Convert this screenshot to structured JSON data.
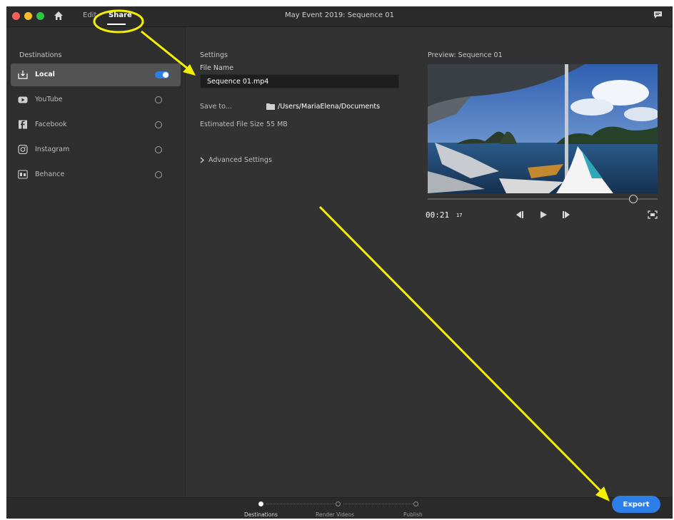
{
  "window": {
    "title": "May Event 2019: Sequence 01"
  },
  "nav": {
    "edit": "Edit",
    "share": "Share"
  },
  "traffic_lights": {
    "close": "#ff5f57",
    "minimize": "#febc2e",
    "zoom": "#28c840"
  },
  "sidebar": {
    "heading": "Destinations",
    "items": [
      {
        "label": "Local",
        "icon": "local-export-icon",
        "enabled": true
      },
      {
        "label": "YouTube",
        "icon": "youtube-icon",
        "enabled": false
      },
      {
        "label": "Facebook",
        "icon": "facebook-icon",
        "enabled": false
      },
      {
        "label": "Instagram",
        "icon": "instagram-icon",
        "enabled": false
      },
      {
        "label": "Behance",
        "icon": "behance-icon",
        "enabled": false
      }
    ]
  },
  "settings": {
    "heading": "Settings",
    "file_name_label": "File Name",
    "file_name_value": "Sequence 01.mp4",
    "save_to_label": "Save to...",
    "save_to_path": "/Users/MariaElena/Documents",
    "estimated_size_label": "Estimated File Size",
    "estimated_size_value": "55 MB",
    "advanced": "Advanced Settings"
  },
  "preview": {
    "heading": "Preview: Sequence 01",
    "timecode": "00:21",
    "frames": "17",
    "playhead_fraction": 0.89
  },
  "steps": [
    {
      "label": "Destinations",
      "state": "current"
    },
    {
      "label": "Render Videos",
      "state": "todo"
    },
    {
      "label": "Publish",
      "state": "todo"
    }
  ],
  "export_label": "Export",
  "accent_color": "#2d7ee6",
  "annotation_color": "#f5f000"
}
